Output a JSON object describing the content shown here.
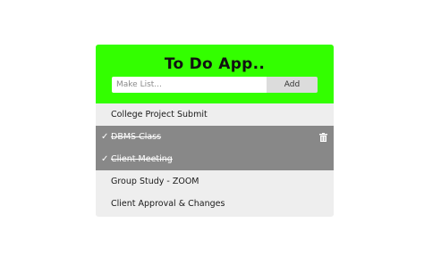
{
  "app": {
    "title": "To Do App..",
    "input_placeholder": "Make List...",
    "add_label": "Add"
  },
  "colors": {
    "header": "#33ff00",
    "list_bg": "#eeeeee",
    "done_bg": "#888888"
  },
  "items": [
    {
      "text": "College Project Submit",
      "done": false
    },
    {
      "text": "DBMS Class",
      "done": true,
      "icons": [
        "check-icon",
        "trash-icon"
      ]
    },
    {
      "text": "Client Meeting",
      "done": true,
      "icons": [
        "check-icon"
      ]
    },
    {
      "text": "Group Study - ZOOM",
      "done": false
    },
    {
      "text": "Client Approval & Changes",
      "done": false
    }
  ]
}
